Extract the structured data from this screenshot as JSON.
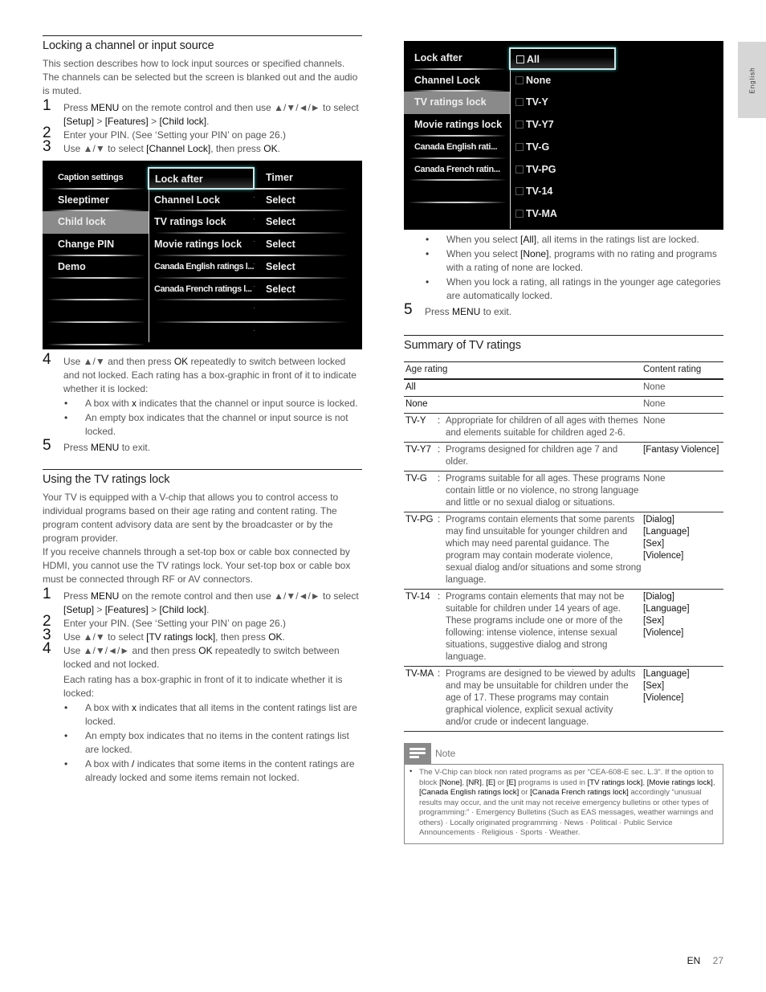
{
  "lang_tab": "English",
  "footer": {
    "lang": "EN",
    "page": "27"
  },
  "left": {
    "section1": {
      "title": "Locking a channel or input source",
      "intro": "This section describes how to lock input sources or specified channels. The channels can be selected but the screen is blanked out and the audio is muted.",
      "steps": [
        {
          "num": "1",
          "parts": [
            "Press ",
            "MENU",
            " on the remote control and then use ▲/▼/◄/► to select ",
            "[Setup]",
            " > ",
            "[Features]",
            " > ",
            "[Child lock]",
            "."
          ]
        },
        {
          "num": "2",
          "parts": [
            "Enter your PIN. (See ‘Setting your PIN’ on page 26.)"
          ]
        },
        {
          "num": "3",
          "parts": [
            "Use ▲/▼ to select ",
            "[Channel Lock]",
            ", then press ",
            "OK",
            "."
          ]
        }
      ],
      "tv_menu": {
        "left_items": [
          "Caption settings",
          "Sleeptimer",
          "Child lock",
          "Change PIN",
          "Demo"
        ],
        "selected_left": "Child lock",
        "mid_items": [
          "Lock after",
          "Channel Lock",
          "TV ratings lock",
          "Movie ratings lock",
          "Canada English ratings l...",
          "Canada French ratings l..."
        ],
        "right_items": [
          "Timer",
          "Select",
          "Select",
          "Select",
          "Select",
          "Select"
        ],
        "focused_mid": "Lock after"
      },
      "step4": {
        "num": "4",
        "parts": [
          "Use ▲/▼ and then press ",
          "OK",
          " repeatedly to switch between locked and not locked. Each rating has a box-graphic in front of it to indicate whether it is locked:"
        ]
      },
      "bullets": [
        [
          "A box with ",
          "x",
          " indicates that the channel or input source is locked."
        ],
        [
          "An empty box indicates that the channel or input source is not locked."
        ]
      ],
      "step5": {
        "num": "5",
        "parts": [
          "Press ",
          "MENU",
          " to exit."
        ]
      }
    },
    "section2": {
      "title": "Using the TV ratings lock",
      "intro1": "Your TV is equipped with a V-chip that allows you to control access to individual programs based on their age rating and content rating. The program content advisory data are sent by the broadcaster or by the program provider.",
      "intro2": "If you receive channels through a set-top box or cable box connected by HDMI, you cannot use the TV ratings lock. Your set-top box or cable box must be connected through RF or AV connectors.",
      "steps": [
        {
          "num": "1",
          "parts": [
            "Press ",
            "MENU",
            " on the remote control and then use ▲/▼/◄/► to select ",
            "[Setup]",
            " > ",
            "[Features]",
            " > ",
            "[Child lock]",
            "."
          ]
        },
        {
          "num": "2",
          "parts": [
            "Enter your PIN. (See ‘Setting your PIN’ on page 26.)"
          ]
        },
        {
          "num": "3",
          "parts": [
            "Use ▲/▼ to select ",
            "[TV ratings lock]",
            ", then press ",
            "OK",
            "."
          ]
        },
        {
          "num": "4",
          "parts": [
            "Use ▲/▼/◄/► and then press ",
            "OK",
            " repeatedly to switch between locked and not locked."
          ]
        }
      ],
      "step4_extra": "Each rating has a box-graphic in front of it to indicate whether it is locked:",
      "bullets": [
        [
          "A box with ",
          "x",
          " indicates that all items in the content ratings list are locked."
        ],
        [
          "An empty box indicates that no items in the content ratings list are locked."
        ],
        [
          "A box with ",
          "/",
          " indicates that some items in the content ratings are already locked and some items remain not locked."
        ]
      ]
    }
  },
  "right": {
    "tv_menu": {
      "left_items": [
        "Lock after",
        "Channel Lock",
        "TV ratings lock",
        "Movie ratings lock",
        "Canada English rati...",
        "Canada French ratin..."
      ],
      "selected_left": "TV ratings lock",
      "options": [
        "All",
        "None",
        "TV-Y",
        "TV-Y7",
        "TV-G",
        "TV-PG",
        "TV-14",
        "TV-MA"
      ],
      "focused_option": "All"
    },
    "bullets": [
      [
        "When you select ",
        "[All]",
        ", all items in the ratings list are locked."
      ],
      [
        "When you select ",
        "[None]",
        ", programs with no rating and programs with a rating of none are locked."
      ],
      [
        "When you lock a rating, all ratings in the younger age categories are automatically locked."
      ]
    ],
    "step5": {
      "num": "5",
      "parts": [
        "Press ",
        "MENU",
        " to exit."
      ]
    },
    "summary": {
      "title": "Summary of TV ratings",
      "headers": [
        "Age rating",
        "Content rating"
      ],
      "rows": [
        {
          "age": "All",
          "desc": "",
          "content": [
            "None"
          ],
          "content_bold": false
        },
        {
          "age": "None",
          "desc": "",
          "content": [
            "None"
          ],
          "content_bold": false
        },
        {
          "age": "TV-Y",
          "desc": "Appropriate for children of all ages with themes and elements suitable for children aged 2-6.",
          "content": [
            "None"
          ],
          "content_bold": false
        },
        {
          "age": "TV-Y7",
          "desc": "Programs designed for children age 7 and older.",
          "content": [
            "[Fantasy Violence]"
          ],
          "content_bold": true
        },
        {
          "age": "TV-G",
          "desc": "Programs suitable for all ages. These programs contain little or no violence, no strong language and little or no sexual dialog or situations.",
          "content": [
            "None"
          ],
          "content_bold": false
        },
        {
          "age": "TV-PG",
          "desc": "Programs contain elements that some parents may find unsuitable for younger children and which may need parental guidance. The program may contain moderate violence, sexual dialog and/or situations and some strong language.",
          "content": [
            "[Dialog]",
            "[Language]",
            "[Sex]",
            "[Violence]"
          ],
          "content_bold": true
        },
        {
          "age": "TV-14",
          "desc": "Programs contain elements that may not be suitable for children under 14 years of age. These programs include one or more of the following: intense violence, intense sexual situations, suggestive dialog and strong language.",
          "content": [
            "[Dialog]",
            "[Language]",
            "[Sex]",
            "[Violence]"
          ],
          "content_bold": true
        },
        {
          "age": "TV-MA",
          "desc": "Programs are designed to be viewed by adults and may be unsuitable for children under the age of 17. These programs may contain graphical violence, explicit sexual activity and/or crude or indecent language.",
          "content": [
            "[Language]",
            "[Sex]",
            "[Violence]"
          ],
          "content_bold": true
        }
      ]
    },
    "note": {
      "label": "Note",
      "parts": [
        "The V-Chip can block non rated programs as per “CEA-608-E sec. L.3”. If the option to block ",
        "[None]",
        ", ",
        "[NR]",
        ", ",
        "[E]",
        " or ",
        "[E]",
        " programs is used in ",
        "[TV ratings lock]",
        ", ",
        "[Movie ratings lock]",
        ", ",
        "[Canada English ratings lock]",
        " or ",
        "[Canada French ratings lock]",
        " accordingly “unusual results may occur, and the unit may not receive emergency bulletins or other types of programming:” · Emergency Bulletins (Such as EAS messages, weather warnings and others) · Locally originated programming · News · Political · Public Service Announcements · Religious · Sports · Weather."
      ]
    }
  }
}
